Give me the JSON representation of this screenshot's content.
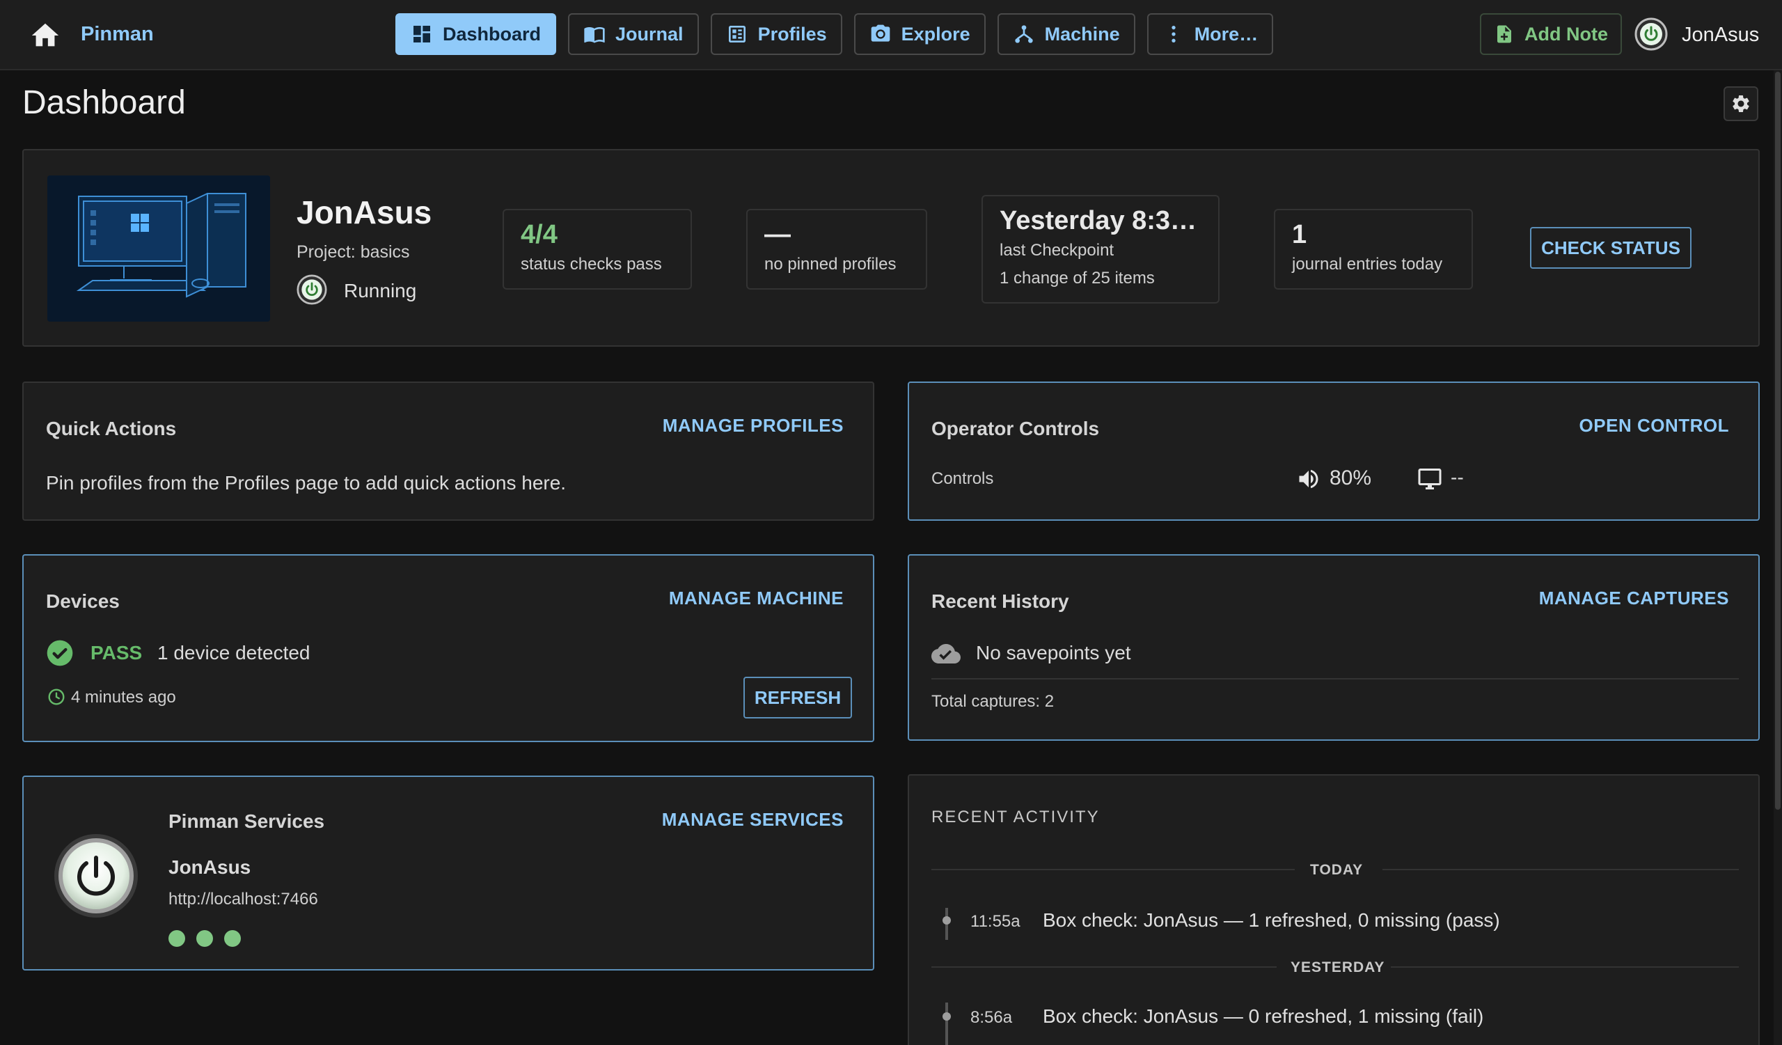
{
  "app": {
    "brand": "Pinman"
  },
  "nav": {
    "items": [
      {
        "label": "Dashboard",
        "icon": "dashboard-icon",
        "active": true
      },
      {
        "label": "Journal",
        "icon": "book-icon"
      },
      {
        "label": "Profiles",
        "icon": "profile-list-icon"
      },
      {
        "label": "Explore",
        "icon": "camera-icon"
      },
      {
        "label": "Machine",
        "icon": "network-icon"
      },
      {
        "label": "More…",
        "icon": "more-vertical-icon"
      }
    ]
  },
  "header": {
    "add_note": "Add Note",
    "user": "JonAsus"
  },
  "page": {
    "title": "Dashboard"
  },
  "summary": {
    "machine_name": "JonAsus",
    "project": "Project: basics",
    "state": "Running",
    "stats": [
      {
        "value": "4/4",
        "label": "status checks pass",
        "value_color": "#81c784"
      },
      {
        "value": "—",
        "label": "no pinned profiles"
      },
      {
        "value": "Yesterday 8:3…",
        "label": "last Checkpoint",
        "label2": "1 change of 25 items"
      },
      {
        "value": "1",
        "label": "journal entries today"
      }
    ],
    "check_status": "CHECK STATUS"
  },
  "quick_actions": {
    "title": "Quick Actions",
    "link": "MANAGE PROFILES",
    "text": "Pin profiles from the Profiles page to add quick actions here."
  },
  "operator_controls": {
    "title": "Operator Controls",
    "link": "OPEN CONTROL",
    "label": "Controls",
    "volume": "80%",
    "display": "--"
  },
  "devices": {
    "title": "Devices",
    "link": "MANAGE MACHINE",
    "status": "PASS",
    "detail": "1 device detected",
    "time": "4 minutes ago",
    "refresh": "REFRESH",
    "status_color": "#66bb6a"
  },
  "recent_history": {
    "title": "Recent History",
    "link": "MANAGE CAPTURES",
    "empty": "No savepoints yet",
    "total": "Total captures: 2"
  },
  "services": {
    "title": "Pinman Services",
    "link": "MANAGE SERVICES",
    "name": "JonAsus",
    "url": "http://localhost:7466",
    "dots": 3
  },
  "recent_activity": {
    "title": "RECENT ACTIVITY",
    "groups": [
      {
        "day": "TODAY",
        "entries": [
          {
            "time": "11:55a",
            "text": "Box check: JonAsus — 1 refreshed, 0 missing (pass)"
          }
        ]
      },
      {
        "day": "YESTERDAY",
        "entries": [
          {
            "time": "8:56a",
            "text": "Box check: JonAsus — 0 refreshed, 1 missing (fail)"
          }
        ]
      }
    ]
  }
}
